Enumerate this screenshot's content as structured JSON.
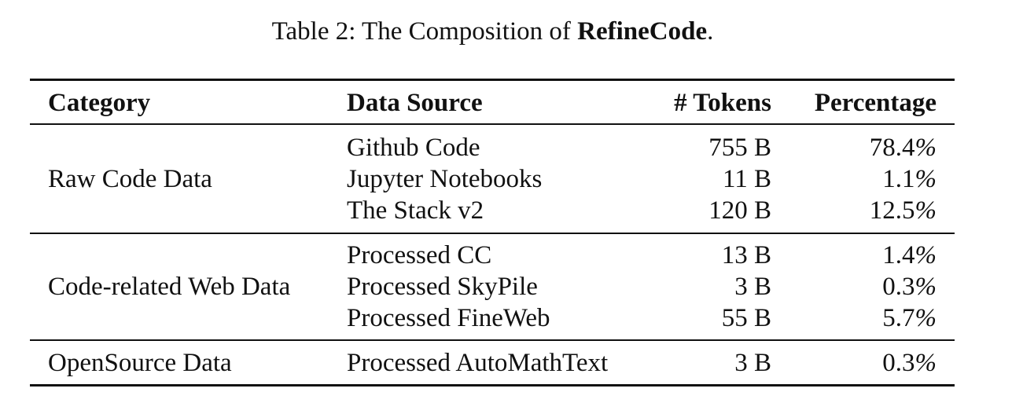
{
  "caption": {
    "prefix": "Table 2: The Composition of ",
    "bold": "RefineCode",
    "suffix": "."
  },
  "table": {
    "headers": [
      "Category",
      "Data Source",
      "# Tokens",
      "Percentage"
    ],
    "groups": [
      {
        "category": "Raw Code Data",
        "rows": [
          {
            "source": "Github Code",
            "tokens": "755 B",
            "percentage": "78.4",
            "unit": "%"
          },
          {
            "source": "Jupyter Notebooks",
            "tokens": "11 B",
            "percentage": "1.1",
            "unit": "%"
          },
          {
            "source": "The Stack v2",
            "tokens": "120 B",
            "percentage": "12.5",
            "unit": "%"
          }
        ]
      },
      {
        "category": "Code-related Web Data",
        "rows": [
          {
            "source": "Processed CC",
            "tokens": "13 B",
            "percentage": "1.4",
            "unit": "%"
          },
          {
            "source": "Processed SkyPile",
            "tokens": "3 B",
            "percentage": "0.3",
            "unit": "%"
          },
          {
            "source": "Processed FineWeb",
            "tokens": "55 B",
            "percentage": "5.7",
            "unit": "%"
          }
        ]
      },
      {
        "category": "OpenSource Data",
        "rows": [
          {
            "source": "Processed AutoMathText",
            "tokens": "3 B",
            "percentage": "0.3",
            "unit": "%"
          }
        ]
      }
    ]
  }
}
